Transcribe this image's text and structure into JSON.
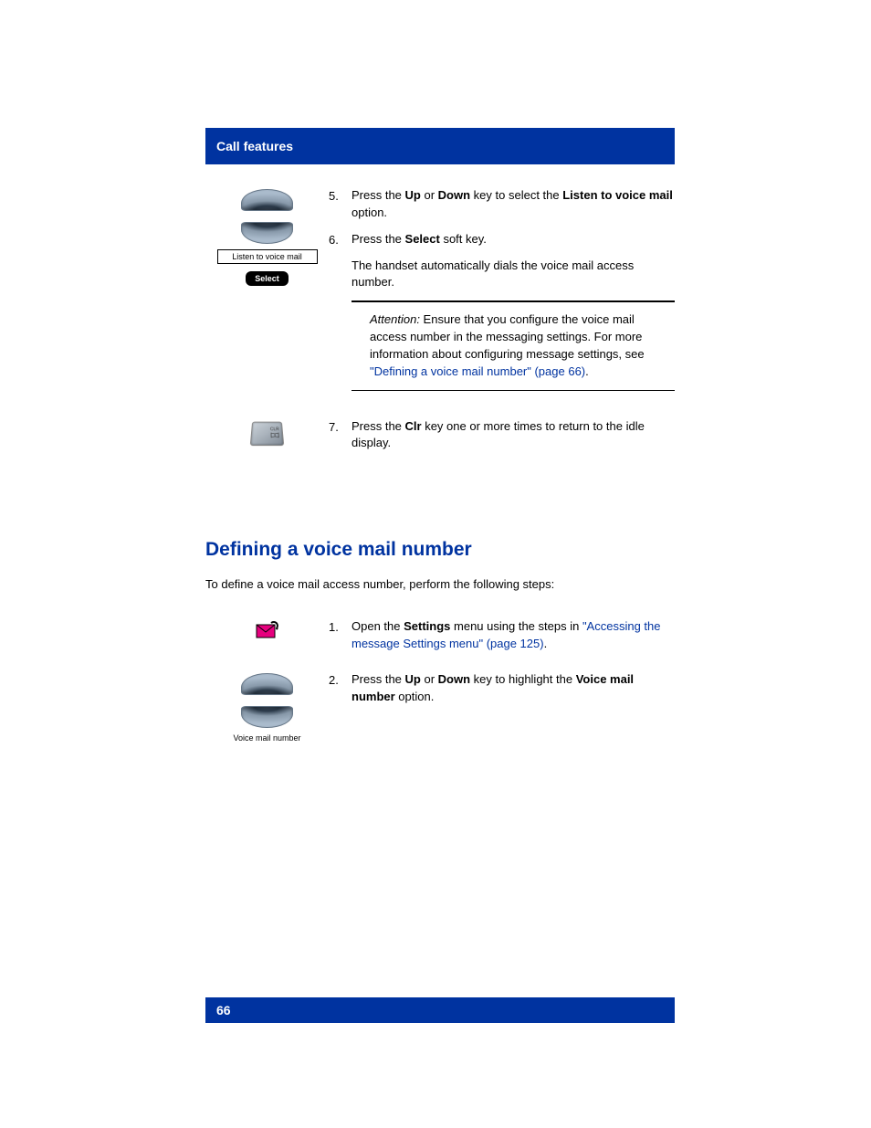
{
  "header": {
    "section_title": "Call features"
  },
  "steps_top": {
    "step5": {
      "num": "5.",
      "text_a": "Press the ",
      "key_up": "Up",
      "text_b": " or ",
      "key_down": "Down",
      "text_c": " key to select the ",
      "option_bold": "Listen to voice mail",
      "text_d": " option."
    },
    "step6": {
      "num": "6.",
      "text_a": "Press the ",
      "softkey_bold": "Select",
      "text_b": " soft key.",
      "followup": "The handset automatically dials the voice mail access number."
    },
    "note": {
      "label": "Attention:",
      "text_a": " Ensure that you configure the voice mail access number in the messaging settings. For more information about configuring message settings, see ",
      "link": "\"Defining a voice mail number\" (page 66)",
      "text_b": "."
    },
    "step7": {
      "num": "7.",
      "text_a": "Press the ",
      "key_bold": "Clr",
      "text_b": " key one or more times to return to the idle display."
    }
  },
  "icons_top": {
    "label_box": "Listen to voice mail",
    "select_btn": "Select",
    "clr_label_top": "CLR",
    "voice_mail_label": "Voice mail number"
  },
  "section2": {
    "heading": "Defining a voice mail number",
    "intro": "To define a voice mail access number, perform the following steps:"
  },
  "steps_bottom": {
    "step1": {
      "num": "1.",
      "text_a": "Open the ",
      "menu_bold": "Settings",
      "text_b": " menu using the steps in ",
      "link": "\"Accessing the message Settings menu\" (page 125)",
      "text_c": "."
    },
    "step2": {
      "num": "2.",
      "text_a": "Press the ",
      "key_up": "Up",
      "text_b": " or ",
      "key_down": "Down",
      "text_c": " key to highlight the ",
      "option_bold": "Voice mail number",
      "text_d": " option."
    }
  },
  "footer": {
    "page_number": "66"
  }
}
